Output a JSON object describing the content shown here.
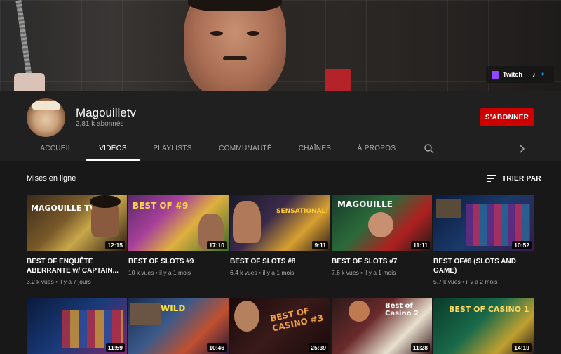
{
  "banner": {
    "links": [
      {
        "label": "Twitch",
        "icon": "twitch-icon"
      },
      {
        "label": "",
        "icon": "tiktok-icon"
      },
      {
        "label": "",
        "icon": "twitter-icon"
      }
    ]
  },
  "channel": {
    "name": "Magouilletv",
    "subscribers": "2,81 k abonnés",
    "subscribe_label": "S'ABONNER"
  },
  "tabs": [
    {
      "label": "ACCUEIL"
    },
    {
      "label": "VIDÉOS"
    },
    {
      "label": "PLAYLISTS"
    },
    {
      "label": "COMMUNAUTÉ"
    },
    {
      "label": "CHAÎNES"
    },
    {
      "label": "À PROPOS"
    }
  ],
  "section": {
    "title": "Mises en ligne",
    "sort_label": "TRIER PAR"
  },
  "videos": [
    {
      "title_line1": "BEST OF ENQUÊTE",
      "title_line2": "ABERRANTE w/ CAPTAIN...",
      "views": "3,2 k vues",
      "age": "il y a 7 jours",
      "duration": "12:15",
      "thumb_text": "MAGOUILLE TV"
    },
    {
      "title_line1": "BEST OF SLOTS #9",
      "title_line2": "",
      "views": "10 k vues",
      "age": "il y a 1 mois",
      "duration": "17:10",
      "thumb_text": "BEST OF #9"
    },
    {
      "title_line1": "BEST OF SLOTS #8",
      "title_line2": "",
      "views": "6,4 k vues",
      "age": "il y a 1 mois",
      "duration": "9:11",
      "thumb_text": "SENSATIONAL!"
    },
    {
      "title_line1": "BEST OF SLOTS #7",
      "title_line2": "",
      "views": "7,6 k vues",
      "age": "il y a 1 mois",
      "duration": "11:11",
      "thumb_text": "MAGOUILLE"
    },
    {
      "title_line1": "BEST OF#6 (SLOTS AND",
      "title_line2": "GAME)",
      "views": "5,7 k vues",
      "age": "il y a 2 mois",
      "duration": "10:52",
      "thumb_text": ""
    },
    {
      "title_line1": "",
      "title_line2": "",
      "views": "",
      "age": "",
      "duration": "11:59",
      "thumb_text": ""
    },
    {
      "title_line1": "",
      "title_line2": "",
      "views": "",
      "age": "",
      "duration": "10:46",
      "thumb_text": "WILD"
    },
    {
      "title_line1": "",
      "title_line2": "",
      "views": "",
      "age": "",
      "duration": "25:39",
      "thumb_text": "BEST OF CASINO #3"
    },
    {
      "title_line1": "",
      "title_line2": "",
      "views": "",
      "age": "",
      "duration": "11:28",
      "thumb_text": "Best of Casino 2"
    },
    {
      "title_line1": "",
      "title_line2": "",
      "views": "",
      "age": "",
      "duration": "14:19",
      "thumb_text": "BEST OF CASINO 1"
    }
  ],
  "colors": {
    "subscribe": "#cc0000",
    "background": "#181818",
    "header": "#202020"
  }
}
